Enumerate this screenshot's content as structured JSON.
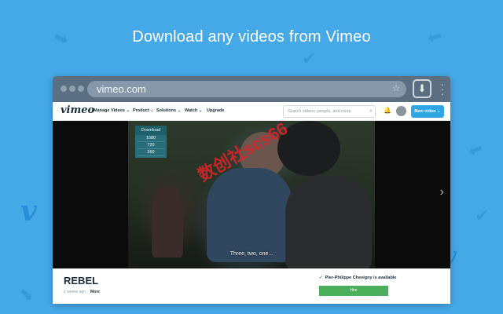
{
  "headline": "Download any videos from Vimeo",
  "browser": {
    "url": "vimeo.com",
    "colors": {
      "chrome": "#5c6f82",
      "page_bg": "#45a9e8"
    }
  },
  "vimeo_nav": {
    "logo": "vimeo",
    "items": [
      "Manage Videos ⌄",
      "Product ⌄",
      "Solutions ⌄",
      "Watch ⌄",
      "Upgrade"
    ],
    "search_placeholder": "Search videos, people, and more",
    "new_video": "New video ⌄"
  },
  "download_panel": {
    "header": "Download",
    "options": [
      "1080",
      "720",
      "360"
    ]
  },
  "player": {
    "subtitle": "Three, two, one...",
    "watermark": "数创社scs66"
  },
  "video_info": {
    "title": "REBEL",
    "meta": "2 weeks ago",
    "more": "More",
    "availability": "Pier-Philippe Chevigny is available",
    "hire_button": "Hire"
  }
}
